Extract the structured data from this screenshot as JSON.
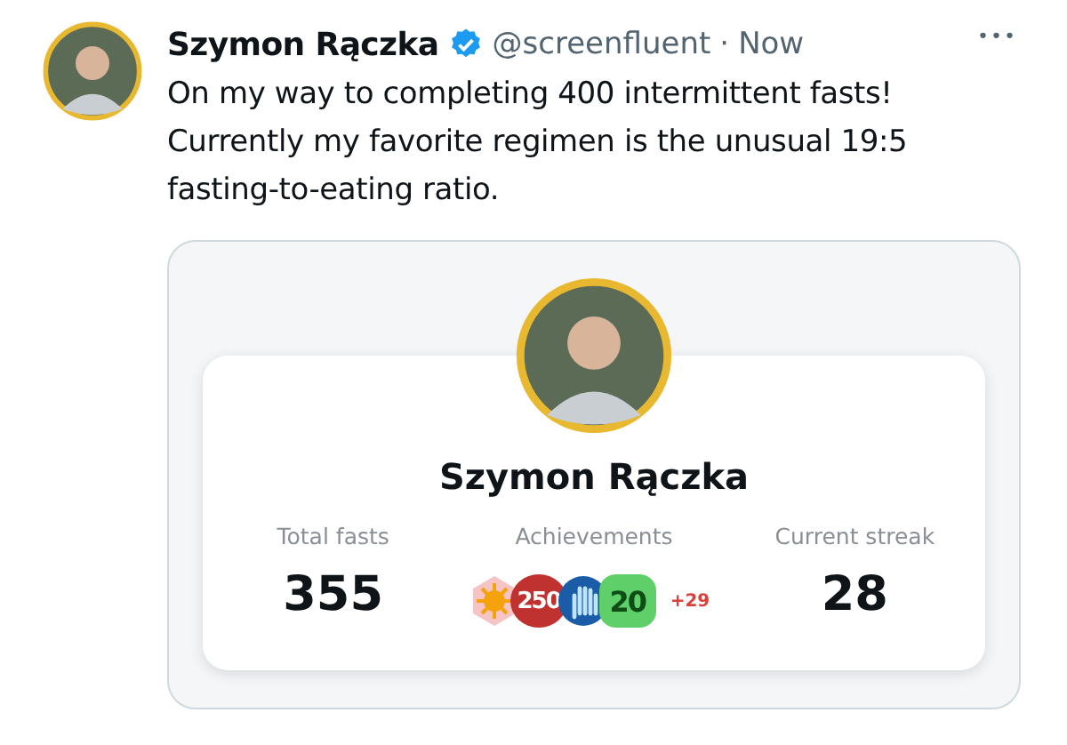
{
  "tweet": {
    "author": "Szymon Rączka",
    "verified": true,
    "handle": "@screenfluent",
    "separator": "·",
    "time": "Now",
    "more": "•••",
    "text": "On my way to completing 400 intermittent fasts! Currently my favorite regimen is the unusual 19:5 fasting-to-eating ratio."
  },
  "card": {
    "name": "Szymon Rączka",
    "stats": [
      {
        "kind": "number",
        "label": "Total fasts",
        "value": "355"
      },
      {
        "kind": "badges",
        "label": "Achievements",
        "badges": [
          {
            "kind": "sun",
            "color": "#f6c4c4"
          },
          {
            "kind": "number",
            "text": "250",
            "color": "#c0322f"
          },
          {
            "kind": "hand",
            "color": "#1a5ca8"
          },
          {
            "kind": "number",
            "text": "20",
            "color": "#5fcf6a"
          }
        ],
        "more": "+29"
      },
      {
        "kind": "number",
        "label": "Current streak",
        "value": "28"
      }
    ]
  }
}
